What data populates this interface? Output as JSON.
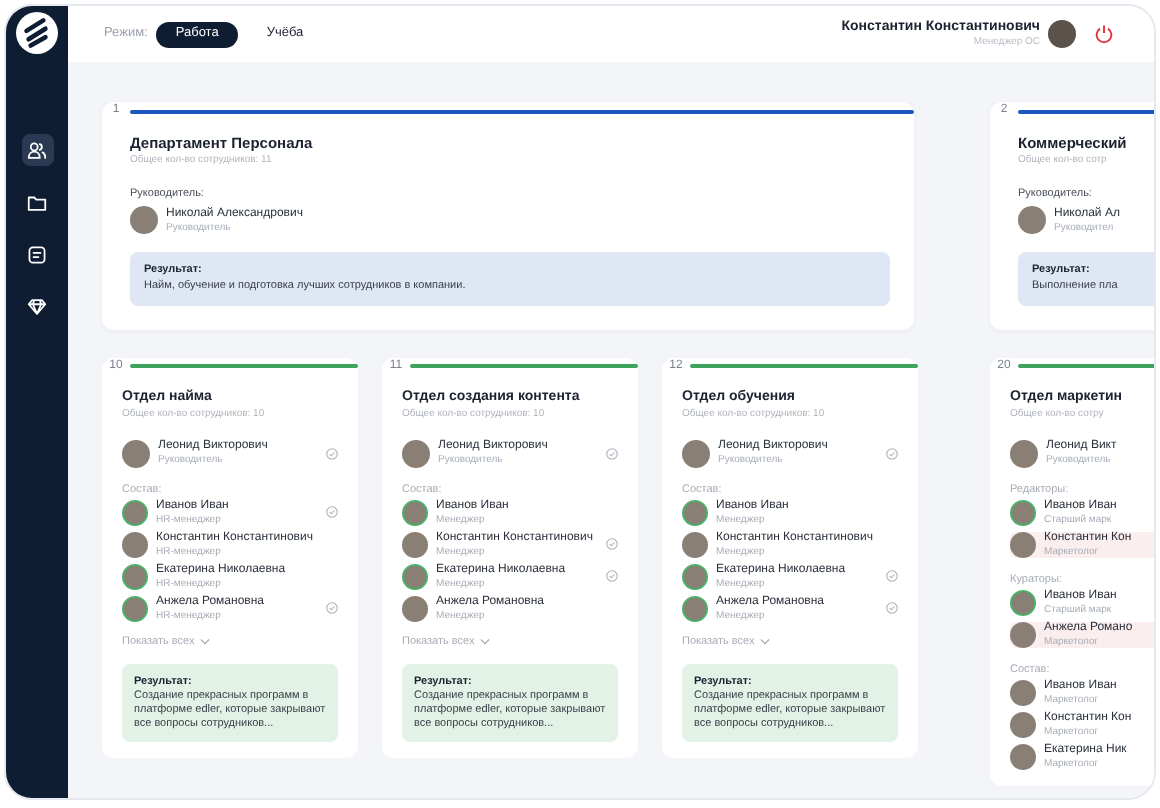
{
  "sidebar": {
    "items": [
      {
        "selected": true
      },
      {
        "selected": false
      },
      {
        "selected": false
      },
      {
        "selected": false
      }
    ]
  },
  "header": {
    "mode_label": "Режим:",
    "tabs": [
      {
        "label": "Работа",
        "selected": true
      },
      {
        "label": "Учёба",
        "selected": false
      }
    ],
    "user": {
      "name": "Константин Константинович",
      "role": "Менеджер ОС"
    }
  },
  "departments": [
    {
      "number": "1",
      "title": "Департамент Персонала",
      "count": "Общее кол-во сотрудников: 11",
      "leader_label": "Руководитель:",
      "leader": {
        "name": "Николай Александрович",
        "role": "Руководитель"
      },
      "result_label": "Результат:",
      "result_text": "Найм, обучение и подготовка лучших сотрудников в компании.",
      "units": [
        {
          "number": "10",
          "title": "Отдел найма",
          "count": "Общее кол-во сотрудников: 10",
          "leader": {
            "name": "Леонид Викторович",
            "role": "Руководитель",
            "checked": true
          },
          "groups": [
            {
              "label": "Состав:",
              "members": [
                {
                  "name": "Иванов Иван",
                  "role": "HR-менеджер",
                  "checked": true,
                  "ringed": true,
                  "marked": false
                },
                {
                  "name": "Константин Константинович",
                  "role": "HR-менеджер",
                  "checked": false,
                  "ringed": false,
                  "marked": false
                },
                {
                  "name": "Екатерина Николаевна",
                  "role": "HR-менеджер",
                  "checked": false,
                  "ringed": true,
                  "marked": false
                },
                {
                  "name": "Анжела Романовна",
                  "role": "HR-менеджер",
                  "checked": true,
                  "ringed": true,
                  "marked": false
                }
              ]
            }
          ],
          "show_all": "Показать всех",
          "result_label": "Результат:",
          "result_text": "Создание прекрасных программ в платформе edler, которые закрывают все вопросы сотрудников..."
        },
        {
          "number": "11",
          "title": "Отдел создания контента",
          "count": "Общее кол-во сотрудников: 10",
          "leader": {
            "name": "Леонид Викторович",
            "role": "Руководитель",
            "checked": true
          },
          "groups": [
            {
              "label": "Состав:",
              "members": [
                {
                  "name": "Иванов Иван",
                  "role": "Менеджер",
                  "checked": false,
                  "ringed": true,
                  "marked": false
                },
                {
                  "name": "Константин Константинович",
                  "role": "Менеджер",
                  "checked": true,
                  "ringed": false,
                  "marked": false
                },
                {
                  "name": "Екатерина Николаевна",
                  "role": "Менеджер",
                  "checked": true,
                  "ringed": true,
                  "marked": false
                },
                {
                  "name": "Анжела Романовна",
                  "role": "Менеджер",
                  "checked": false,
                  "ringed": false,
                  "marked": false
                }
              ]
            }
          ],
          "show_all": "Показать всех",
          "result_label": "Результат:",
          "result_text": "Создание прекрасных программ в платформе edler, которые закрывают все вопросы сотрудников..."
        },
        {
          "number": "12",
          "title": "Отдел обучения",
          "count": "Общее кол-во сотрудников: 10",
          "leader": {
            "name": "Леонид Викторович",
            "role": "Руководитель",
            "checked": true
          },
          "groups": [
            {
              "label": "Состав:",
              "members": [
                {
                  "name": "Иванов Иван",
                  "role": "Менеджер",
                  "checked": false,
                  "ringed": true,
                  "marked": false
                },
                {
                  "name": "Константин Константинович",
                  "role": "Менеджер",
                  "checked": false,
                  "ringed": false,
                  "marked": false
                },
                {
                  "name": "Екатерина Николаевна",
                  "role": "Менеджер",
                  "checked": true,
                  "ringed": true,
                  "marked": false
                },
                {
                  "name": "Анжела Романовна",
                  "role": "Менеджер",
                  "checked": true,
                  "ringed": true,
                  "marked": false
                }
              ]
            }
          ],
          "show_all": "Показать всех",
          "result_label": "Результат:",
          "result_text": "Создание прекрасных программ в платформе edler, которые закрывают все вопросы сотрудников..."
        }
      ]
    },
    {
      "number": "2",
      "title": "Коммерческий",
      "count": "Общее кол-во сотр",
      "leader_label": "Руководитель:",
      "leader": {
        "name": "Николай Ал",
        "role": "Руководител"
      },
      "result_label": "Результат:",
      "result_text": "Выполнение пла",
      "units": [
        {
          "number": "20",
          "title": "Отдел маркетин",
          "count": "Общее кол-во сотру",
          "leader": {
            "name": "Леонид Викт",
            "role": "Руководитель",
            "checked": false
          },
          "groups": [
            {
              "label": "Редакторы:",
              "members": [
                {
                  "name": "Иванов Иван",
                  "role": "Старший марк",
                  "checked": false,
                  "ringed": true,
                  "marked": false
                },
                {
                  "name": "Константин Кон",
                  "role": "Маркетолог",
                  "checked": false,
                  "ringed": false,
                  "marked": true
                }
              ]
            },
            {
              "label": "Кураторы:",
              "members": [
                {
                  "name": "Иванов Иван",
                  "role": "Старший марк",
                  "checked": false,
                  "ringed": true,
                  "marked": false
                },
                {
                  "name": "Анжела Романо",
                  "role": "Маркетолог",
                  "checked": false,
                  "ringed": false,
                  "marked": true
                }
              ]
            },
            {
              "label": "Состав:",
              "members": [
                {
                  "name": "Иванов Иван",
                  "role": "Маркетолог",
                  "checked": false,
                  "ringed": false,
                  "marked": false
                },
                {
                  "name": "Константин Кон",
                  "role": "Маркетолог",
                  "checked": false,
                  "ringed": false,
                  "marked": false
                },
                {
                  "name": "Екатерина Ник",
                  "role": "Маркетолог",
                  "checked": false,
                  "ringed": false,
                  "marked": false
                }
              ]
            }
          ]
        }
      ]
    }
  ]
}
